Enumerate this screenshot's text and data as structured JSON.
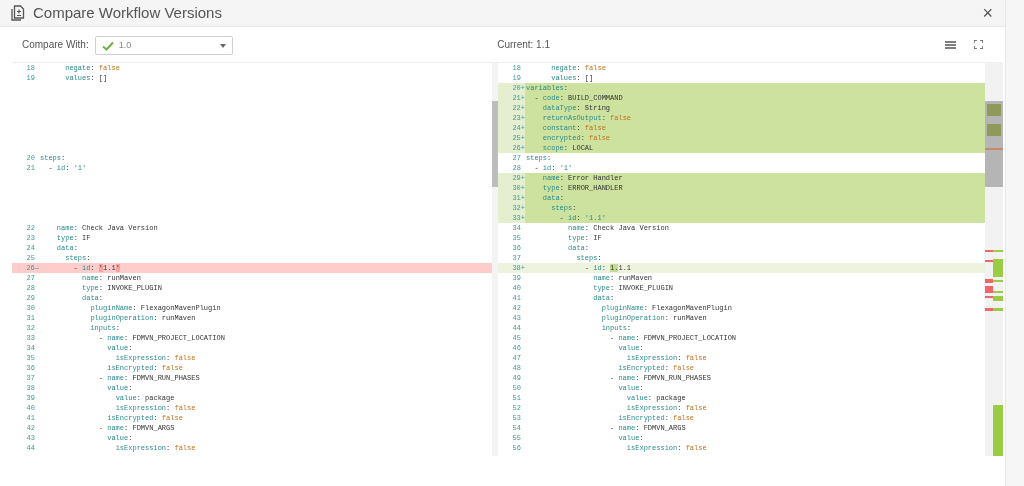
{
  "window": {
    "title": "Compare Workflow Versions",
    "close": "×"
  },
  "toolbar": {
    "compare_label": "Compare With:",
    "compare_value": "1.0",
    "current": "Current: 1.1"
  },
  "left_pane": {
    "lines": [
      {
        "kind": "context",
        "number": "18",
        "key": "      negate:",
        "value": {
          "kind": "boolean",
          "text": "false"
        }
      },
      {
        "kind": "context",
        "number": "19",
        "key": "      values:",
        "value": {
          "kind": "plain",
          "text": "[]"
        }
      },
      {
        "kind": "filler"
      },
      {
        "kind": "filler"
      },
      {
        "kind": "filler"
      },
      {
        "kind": "filler"
      },
      {
        "kind": "filler"
      },
      {
        "kind": "filler"
      },
      {
        "kind": "filler"
      },
      {
        "kind": "context",
        "number": "20",
        "key": "steps:"
      },
      {
        "kind": "context",
        "number": "21",
        "key": "  - id:",
        "value": {
          "kind": "string",
          "text": "'1'"
        }
      },
      {
        "kind": "filler"
      },
      {
        "kind": "filler"
      },
      {
        "kind": "filler"
      },
      {
        "kind": "filler"
      },
      {
        "kind": "filler"
      },
      {
        "kind": "context",
        "number": "22",
        "key": "    name:",
        "value": {
          "kind": "plain",
          "text": "Check Java Version"
        }
      },
      {
        "kind": "context",
        "number": "23",
        "key": "    type:",
        "value": {
          "kind": "plain",
          "text": "IF"
        }
      },
      {
        "kind": "context",
        "number": "24",
        "key": "    data:"
      },
      {
        "kind": "context",
        "number": "25",
        "key": "      steps:"
      },
      {
        "kind": "removed",
        "number": "26",
        "marker": "—",
        "key": "        - id:",
        "value": {
          "kind": "plain",
          "parts": [
            {
              "text": "'",
              "changed": true
            },
            {
              "text": "1.1",
              "changed": false
            },
            {
              "text": "'",
              "changed": true
            }
          ]
        }
      },
      {
        "kind": "context",
        "number": "27",
        "key": "          name:",
        "value": {
          "kind": "plain",
          "text": "runMaven"
        }
      },
      {
        "kind": "context",
        "number": "28",
        "key": "          type:",
        "value": {
          "kind": "plain",
          "text": "INVOKE_PLUGIN"
        }
      },
      {
        "kind": "context",
        "number": "29",
        "key": "          data:"
      },
      {
        "kind": "context",
        "number": "30",
        "key": "            pluginName:",
        "value": {
          "kind": "plain",
          "text": "FlexagonMavenPlugin"
        }
      },
      {
        "kind": "context",
        "number": "31",
        "key": "            pluginOperation:",
        "value": {
          "kind": "plain",
          "text": "runMaven"
        }
      },
      {
        "kind": "context",
        "number": "32",
        "key": "            inputs:"
      },
      {
        "kind": "context",
        "number": "33",
        "key": "              - name:",
        "value": {
          "kind": "plain",
          "text": "FDMVN_PROJECT_LOCATION"
        }
      },
      {
        "kind": "context",
        "number": "34",
        "key": "                value:"
      },
      {
        "kind": "context",
        "number": "35",
        "key": "                  isExpression:",
        "value": {
          "kind": "boolean",
          "text": "false"
        }
      },
      {
        "kind": "context",
        "number": "36",
        "key": "                isEncrypted:",
        "value": {
          "kind": "boolean",
          "text": "false"
        }
      },
      {
        "kind": "context",
        "number": "37",
        "key": "              - name:",
        "value": {
          "kind": "plain",
          "text": "FDMVN_RUN_PHASES"
        }
      },
      {
        "kind": "context",
        "number": "38",
        "key": "                value:"
      },
      {
        "kind": "context",
        "number": "39",
        "key": "                  value:",
        "value": {
          "kind": "plain",
          "text": "package"
        }
      },
      {
        "kind": "context",
        "number": "40",
        "key": "                  isExpression:",
        "value": {
          "kind": "boolean",
          "text": "false"
        }
      },
      {
        "kind": "context",
        "number": "41",
        "key": "                isEncrypted:",
        "value": {
          "kind": "boolean",
          "text": "false"
        }
      },
      {
        "kind": "context",
        "number": "42",
        "key": "              - name:",
        "value": {
          "kind": "plain",
          "text": "FDMVN_ARGS"
        }
      },
      {
        "kind": "context",
        "number": "43",
        "key": "                value:"
      },
      {
        "kind": "context",
        "number": "44",
        "key": "                  isExpression:",
        "value": {
          "kind": "boolean",
          "text": "false"
        }
      }
    ]
  },
  "right_pane": {
    "lines": [
      {
        "kind": "context",
        "number": "18",
        "key": "      negate:",
        "value": {
          "kind": "boolean",
          "text": "false"
        }
      },
      {
        "kind": "context",
        "number": "19",
        "key": "      values:",
        "value": {
          "kind": "plain",
          "text": "[]"
        }
      },
      {
        "kind": "added",
        "number": "20",
        "marker": "+",
        "key": "variables:"
      },
      {
        "kind": "added",
        "number": "21",
        "marker": "+",
        "key": "  - code:",
        "value": {
          "kind": "plain",
          "text": "BUILD_COMMAND"
        }
      },
      {
        "kind": "added",
        "number": "22",
        "marker": "+",
        "key": "    dataType:",
        "value": {
          "kind": "plain",
          "text": "String"
        }
      },
      {
        "kind": "added",
        "number": "23",
        "marker": "+",
        "key": "    returnAsOutput:",
        "value": {
          "kind": "boolean",
          "text": "false"
        }
      },
      {
        "kind": "added",
        "number": "24",
        "marker": "+",
        "key": "    constant:",
        "value": {
          "kind": "boolean",
          "text": "false"
        }
      },
      {
        "kind": "added",
        "number": "25",
        "marker": "+",
        "key": "    encrypted:",
        "value": {
          "kind": "boolean",
          "text": "false"
        }
      },
      {
        "kind": "added",
        "number": "26",
        "marker": "+",
        "key": "    scope:",
        "value": {
          "kind": "plain",
          "text": "LOCAL"
        }
      },
      {
        "kind": "context",
        "number": "27",
        "key": "steps:"
      },
      {
        "kind": "context",
        "number": "28",
        "key": "  - id:",
        "value": {
          "kind": "string",
          "text": "'1'"
        }
      },
      {
        "kind": "added",
        "number": "29",
        "marker": "+",
        "key": "    name:",
        "value": {
          "kind": "plain",
          "text": "Error Handler"
        }
      },
      {
        "kind": "added",
        "number": "30",
        "marker": "+",
        "key": "    type:",
        "value": {
          "kind": "plain",
          "text": "ERROR_HANDLER"
        }
      },
      {
        "kind": "added",
        "number": "31",
        "marker": "+",
        "key": "    data:"
      },
      {
        "kind": "added",
        "number": "32",
        "marker": "+",
        "key": "      steps:"
      },
      {
        "kind": "added",
        "number": "33",
        "marker": "+",
        "key": "        - id:",
        "value": {
          "kind": "string",
          "text": "'1.1'"
        }
      },
      {
        "kind": "context",
        "number": "34",
        "key": "          name:",
        "value": {
          "kind": "plain",
          "text": "Check Java Version"
        }
      },
      {
        "kind": "context",
        "number": "35",
        "key": "          type:",
        "value": {
          "kind": "plain",
          "text": "IF"
        }
      },
      {
        "kind": "context",
        "number": "36",
        "key": "          data:"
      },
      {
        "kind": "context",
        "number": "37",
        "key": "            steps:"
      },
      {
        "kind": "modified",
        "number": "38",
        "marker": "+",
        "key": "              - id:",
        "value": {
          "kind": "plain",
          "parts": [
            {
              "text": "1.",
              "changed": true
            },
            {
              "text": "1.1",
              "changed": false
            }
          ]
        }
      },
      {
        "kind": "context",
        "number": "39",
        "key": "                name:",
        "value": {
          "kind": "plain",
          "text": "runMaven"
        }
      },
      {
        "kind": "context",
        "number": "40",
        "key": "                type:",
        "value": {
          "kind": "plain",
          "text": "INVOKE_PLUGIN"
        }
      },
      {
        "kind": "context",
        "number": "41",
        "key": "                data:"
      },
      {
        "kind": "context",
        "number": "42",
        "key": "                  pluginName:",
        "value": {
          "kind": "plain",
          "text": "FlexagonMavenPlugin"
        }
      },
      {
        "kind": "context",
        "number": "43",
        "key": "                  pluginOperation:",
        "value": {
          "kind": "plain",
          "text": "runMaven"
        }
      },
      {
        "kind": "context",
        "number": "44",
        "key": "                  inputs:"
      },
      {
        "kind": "context",
        "number": "45",
        "key": "                    - name:",
        "value": {
          "kind": "plain",
          "text": "FDMVN_PROJECT_LOCATION"
        }
      },
      {
        "kind": "context",
        "number": "46",
        "key": "                      value:"
      },
      {
        "kind": "context",
        "number": "47",
        "key": "                        isExpression:",
        "value": {
          "kind": "boolean",
          "text": "false"
        }
      },
      {
        "kind": "context",
        "number": "48",
        "key": "                      isEncrypted:",
        "value": {
          "kind": "boolean",
          "text": "false"
        }
      },
      {
        "kind": "context",
        "number": "49",
        "key": "                    - name:",
        "value": {
          "kind": "plain",
          "text": "FDMVN_RUN_PHASES"
        }
      },
      {
        "kind": "context",
        "number": "50",
        "key": "                      value:"
      },
      {
        "kind": "context",
        "number": "51",
        "key": "                        value:",
        "value": {
          "kind": "plain",
          "text": "package"
        }
      },
      {
        "kind": "context",
        "number": "52",
        "key": "                        isExpression:",
        "value": {
          "kind": "boolean",
          "text": "false"
        }
      },
      {
        "kind": "context",
        "number": "53",
        "key": "                      isEncrypted:",
        "value": {
          "kind": "boolean",
          "text": "false"
        }
      },
      {
        "kind": "context",
        "number": "54",
        "key": "                    - name:",
        "value": {
          "kind": "plain",
          "text": "FDMVN_ARGS"
        }
      },
      {
        "kind": "context",
        "number": "55",
        "key": "                      value:"
      },
      {
        "kind": "context",
        "number": "56",
        "key": "                        isExpression:",
        "value": {
          "kind": "boolean",
          "text": "false"
        }
      }
    ]
  }
}
